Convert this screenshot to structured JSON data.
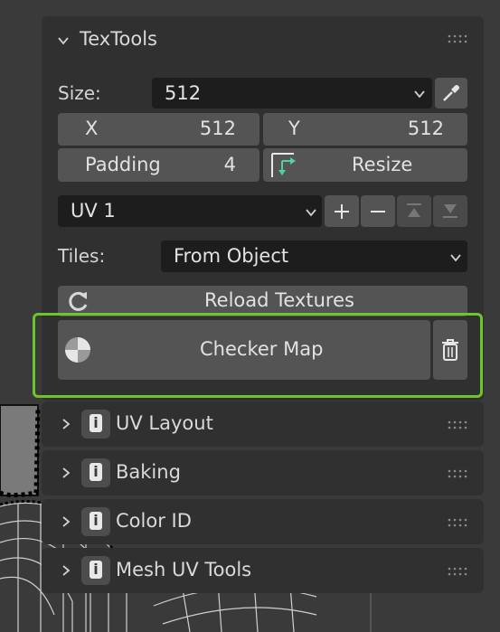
{
  "panel": {
    "title": "TexTools",
    "size_label": "Size:",
    "size_value": "512",
    "x_label": "X",
    "x_value": "512",
    "y_label": "Y",
    "y_value": "512",
    "padding_label": "Padding",
    "padding_value": "4",
    "resize_label": "Resize",
    "uv_value": "UV 1",
    "tiles_label": "Tiles:",
    "tiles_value": "From Object",
    "reload_label": "Reload Textures",
    "checker_label": "Checker Map"
  },
  "collapsed_panels": [
    {
      "title": "UV Layout"
    },
    {
      "title": "Baking"
    },
    {
      "title": "Color ID"
    },
    {
      "title": "Mesh UV Tools"
    }
  ],
  "colors": {
    "highlight": "#6fc42a",
    "panel_bg": "#303030",
    "button_bg": "#545454",
    "field_bg": "#1d1d1d",
    "resize_icon": "#4fd1a0"
  }
}
